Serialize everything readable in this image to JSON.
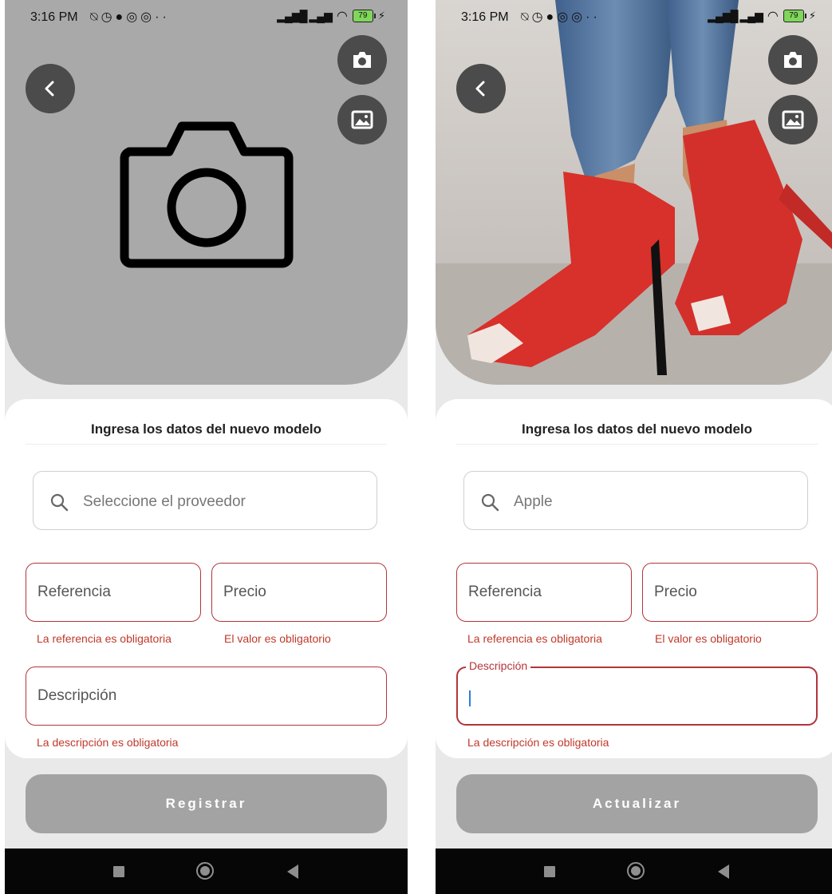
{
  "status": {
    "time": "3:16 PM",
    "battery": "79"
  },
  "screens": [
    {
      "form_title": "Ingresa los datos del nuevo modelo",
      "search_text": "Seleccione el proveedor",
      "ref_label": "Referencia",
      "precio_label": "Precio",
      "desc_label": "Descripción",
      "err_ref": "La referencia es obligatoria",
      "err_val": "El valor es obligatorio",
      "err_desc": "La descripción es obligatoria",
      "button_label": "Registrar"
    },
    {
      "form_title": "Ingresa los datos del nuevo modelo",
      "search_text": "Apple",
      "ref_label": "Referencia",
      "precio_label": "Precio",
      "desc_label": "Descripción",
      "err_ref": "La referencia es obligatoria",
      "err_val": "El valor es obligatorio",
      "err_desc": "La descripción es obligatoria",
      "button_label": "Actualizar"
    }
  ],
  "icons": {
    "back": "chevron-left-icon",
    "camera": "camera-icon",
    "gallery": "image-icon",
    "search": "search-icon",
    "placeholder": "camera-outline-icon"
  },
  "colors": {
    "error": "#b3343a",
    "button": "#a3a3a3",
    "hero_gray": "#a9a9a9",
    "caret": "#2a7de1"
  }
}
